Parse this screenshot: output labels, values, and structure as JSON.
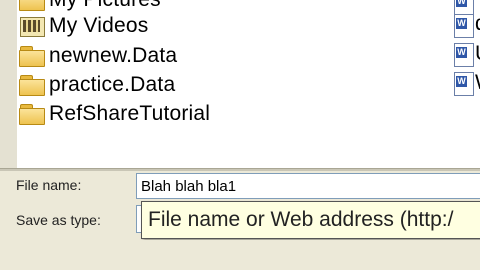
{
  "folders": [
    {
      "label": "My Pictures",
      "icon": "folder-icon"
    },
    {
      "label": "My Videos",
      "icon": "video-folder-icon"
    },
    {
      "label": "newnew.Data",
      "icon": "folder-icon"
    },
    {
      "label": "practice.Data",
      "icon": "folder-icon"
    },
    {
      "label": "RefShareTutorial",
      "icon": "folder-icon"
    }
  ],
  "documents": [
    {
      "label": ""
    },
    {
      "label": "q"
    },
    {
      "label": "U"
    },
    {
      "label": "W"
    }
  ],
  "form": {
    "file_name_label": "File name:",
    "file_name_value": "Blah blah bla1",
    "save_as_type_label": "Save as type:"
  },
  "tooltip": {
    "text": "File name or Web address (http:/"
  },
  "colors": {
    "window_bg": "#ece9d8",
    "tooltip_bg": "#ffffe1",
    "input_border": "#7f9db9"
  }
}
